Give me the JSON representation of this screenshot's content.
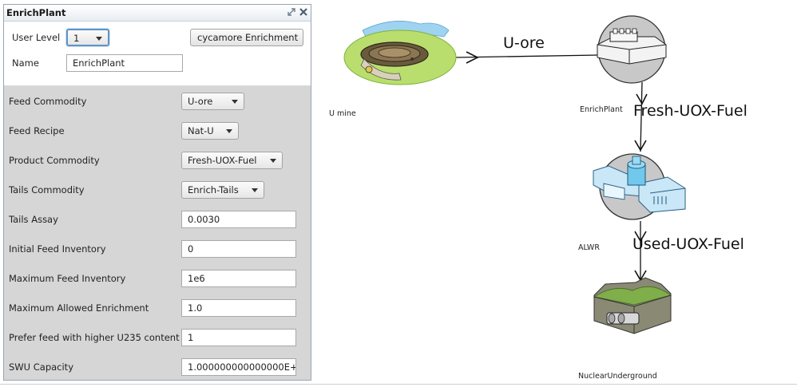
{
  "panel": {
    "title": "EnrichPlant",
    "user_level_label": "User Level",
    "user_level_value": "1",
    "name_label": "Name",
    "name_value": "EnrichPlant",
    "archetype_button": "cycamore Enrichment",
    "fields": {
      "feed_commodity": {
        "label": "Feed Commodity",
        "value": "U-ore"
      },
      "feed_recipe": {
        "label": "Feed Recipe",
        "value": "Nat-U"
      },
      "product_commodity": {
        "label": "Product Commodity",
        "value": "Fresh-UOX-Fuel"
      },
      "tails_commodity": {
        "label": "Tails Commodity",
        "value": "Enrich-Tails"
      },
      "tails_assay": {
        "label": "Tails Assay",
        "value": "0.0030"
      },
      "initial_feed_inventory": {
        "label": "Initial Feed Inventory",
        "value": "0"
      },
      "max_feed_inventory": {
        "label": "Maximum Feed Inventory",
        "value": "1e6"
      },
      "max_allowed_enrichment": {
        "label": "Maximum Allowed Enrichment",
        "value": "1.0"
      },
      "prefer_higher_u235": {
        "label": "Prefer feed with higher U235 content",
        "value": "1"
      },
      "swu_capacity": {
        "label": "SWU Capacity",
        "value": "1.000000000000000E+"
      }
    }
  },
  "canvas": {
    "nodes": {
      "u_mine": "U mine",
      "enrich_plant": "EnrichPlant",
      "alwr": "ALWR",
      "nuclear_underground": "NuclearUnderground"
    },
    "edges": {
      "u_ore": "U-ore",
      "fresh_uox_fuel": "Fresh-UOX-Fuel",
      "used_uox_fuel": "Used-UOX-Fuel"
    }
  },
  "icons": {
    "expand": "expand-icon",
    "close": "close-icon",
    "dropdown": "chevron-down-icon"
  },
  "colors": {
    "panel_border": "#9aa6b2",
    "form_background": "#d6d6d6",
    "focus_ring": "#5f93c7",
    "facility_circle": "#c8c8c8"
  }
}
